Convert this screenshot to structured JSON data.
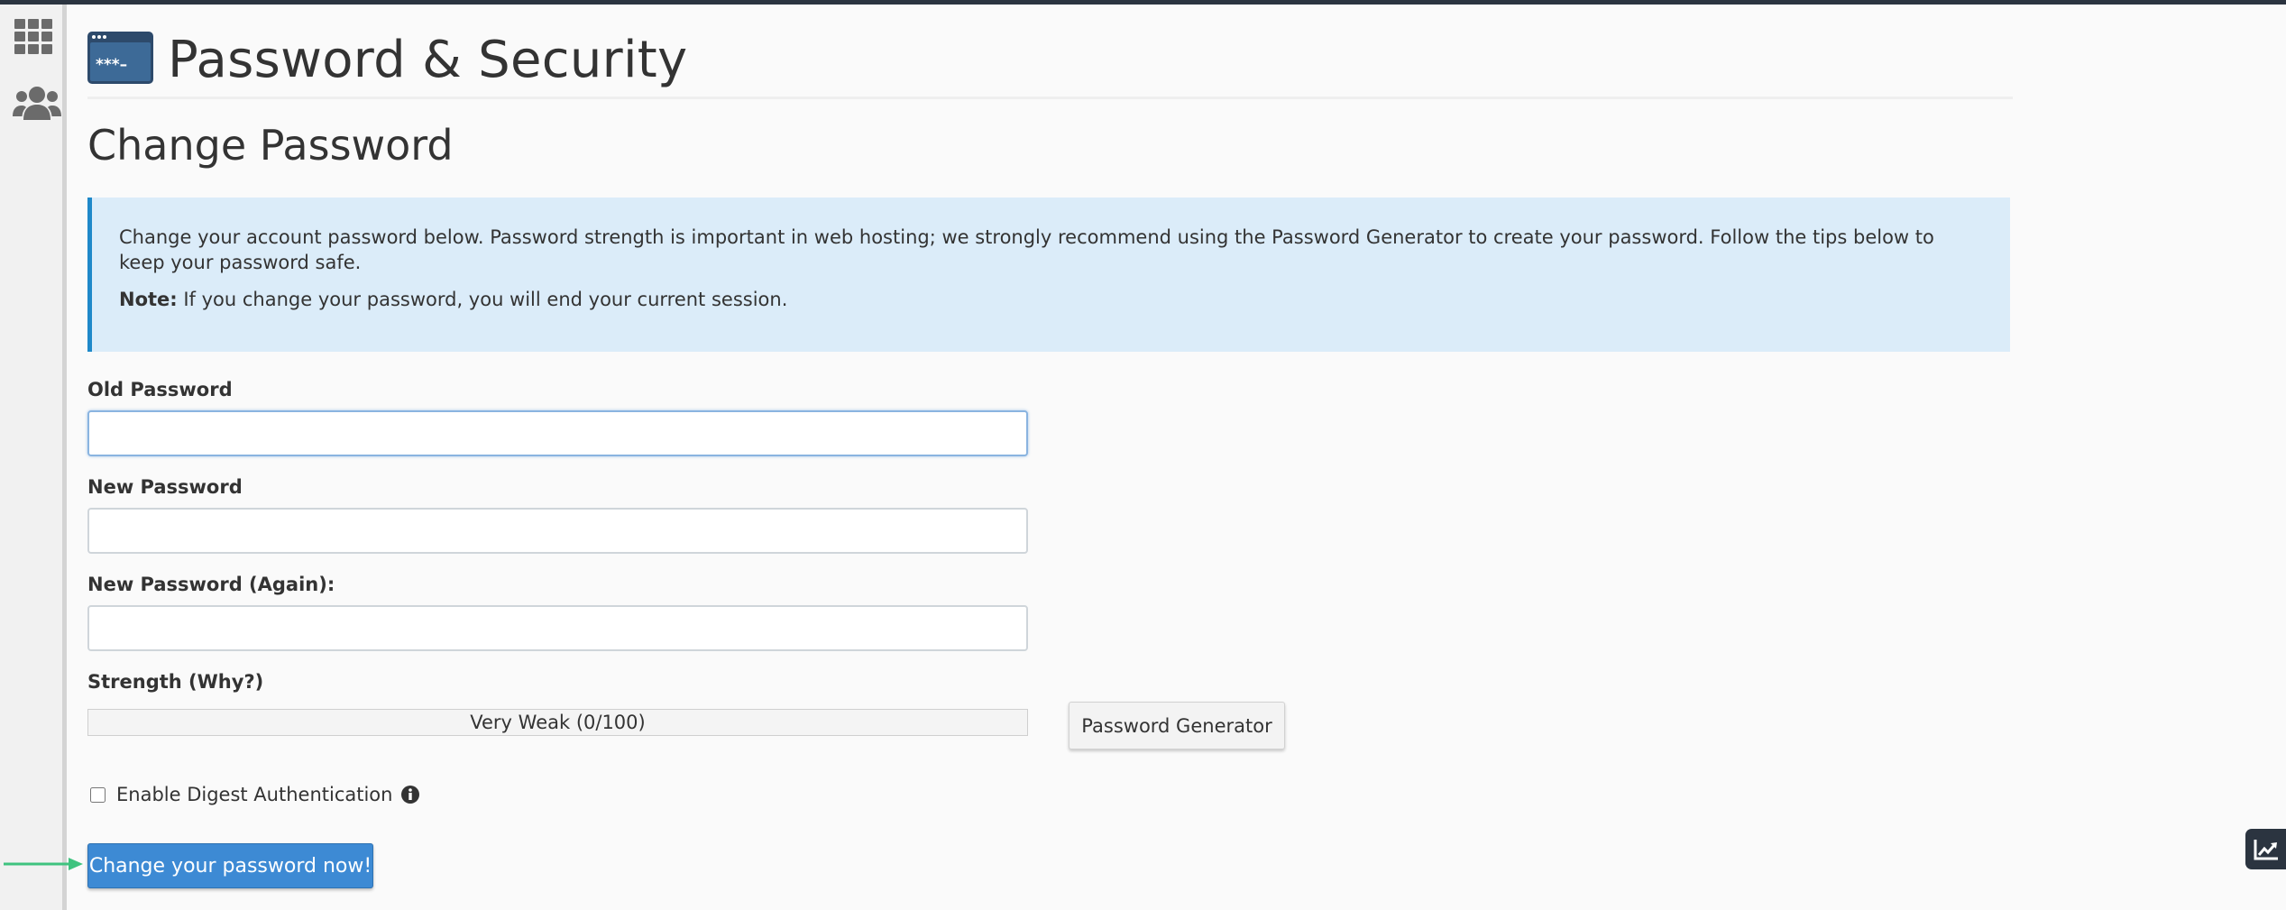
{
  "header": {
    "title": "Password & Security",
    "icon_text": "***–"
  },
  "section": {
    "title": "Change Password"
  },
  "info": {
    "text": "Change your account password below. Password strength is important in web hosting; we strongly recommend using the Password Generator to create your password. Follow the tips below to keep your password safe.",
    "note_label": "Note:",
    "note_text": " If you change your password, you will end your current session."
  },
  "form": {
    "old_password_label": "Old Password",
    "old_password_value": "",
    "new_password_label": "New Password",
    "new_password_value": "",
    "new_password_again_label": "New Password (Again):",
    "new_password_again_value": "",
    "strength_label": "Strength (Why?)",
    "strength_text": "Very Weak (0/100)",
    "strength_score": 0,
    "generator_label": "Password Generator",
    "digest_label": "Enable Digest Authentication",
    "digest_checked": false,
    "submit_label": "Change your password now!"
  },
  "colors": {
    "primary": "#3d8ad4",
    "info_bg": "#dbecf9",
    "info_border": "#1e88c9",
    "arrow": "#3fc37f",
    "topbar": "#2b3440"
  },
  "icons": {
    "sidebar": [
      "grid-icon",
      "users-icon"
    ],
    "header": "password-window-icon",
    "digest_info": "info-icon",
    "stats": "trend-chart-icon"
  }
}
